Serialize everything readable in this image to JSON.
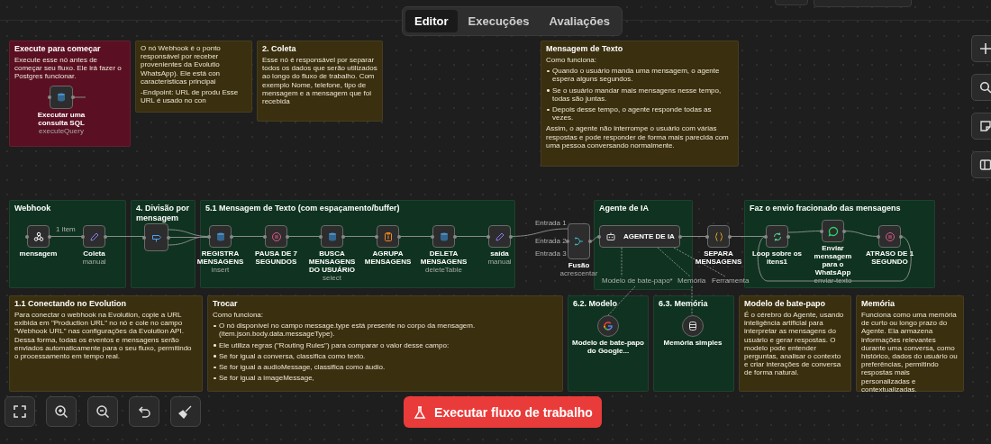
{
  "tabs": [
    {
      "label": "Editor",
      "selected": true
    },
    {
      "label": "Execuções",
      "selected": false
    },
    {
      "label": "Avaliações",
      "selected": false
    }
  ],
  "stickies": [
    {
      "title": "Execute para começar",
      "color": "#5a0f22",
      "body": [
        {
          "kind": "text",
          "text": "Execute esse nó antes de começar seu fluxo. Ele irá fazer o Postgres funcionar."
        }
      ]
    },
    {
      "color": "#3a2f0e",
      "body": [
        {
          "kind": "text",
          "text": "O nó Webhook é o ponto responsável por receber provenientes da Evolutio WhatsApp). Ele está con características principai"
        },
        {
          "kind": "text",
          "text": "-Endpoint: URL de produ Esse URL é usado no con"
        }
      ]
    },
    {
      "title": "2. Coleta",
      "color": "#3a2f0e",
      "body": [
        {
          "kind": "text",
          "text": "Esse nó é responsável por separar todos os dados que serão utilizados ao longo do fluxo de trabalho. Com exemplo Nome, telefone, tipo de mensagem e a mensagem que foi recebida"
        }
      ]
    },
    {
      "title": "Webhook",
      "color": "#0f3320"
    },
    {
      "title": "4. Divisão por mensagem",
      "color": "#0f3320"
    },
    {
      "title": "1.1 Conectando no Evolution",
      "color": "#3a2f0e",
      "body": [
        {
          "kind": "text",
          "text": "Para conectar o webhook na Evolution, copie a URL exibida em \"Production URL\" no nó e cole no campo \"Webhook URL\" nas configurações da Evolution API. Dessa forma, todas os eventos e mensagens serão enviados automaticamente para o seu fluxo, permitindo o processamento em tempo real."
        }
      ]
    },
    {
      "title": "5.1 Mensagem de Texto (com espaçamento/buffer)",
      "color": "#0f3320"
    },
    {
      "title": "Mensagem de Texto",
      "color": "#3a2f0e",
      "body": [
        {
          "kind": "text",
          "text": "Como funciona:"
        },
        {
          "kind": "bullet",
          "text": "Quando o usuário manda uma mensagem, o agente espera alguns segundos."
        },
        {
          "kind": "bullet",
          "text": "Se o usuário mandar mais mensagens nesse tempo, todas são juntas."
        },
        {
          "kind": "bullet",
          "text": "Depois desse tempo, o agente responde todas as vezes."
        },
        {
          "kind": "text",
          "text": "Assim, o agente não interrompe o usuário com várias respostas e pode responder de forma mais parecida com uma pessoa conversando normalmente."
        }
      ]
    },
    {
      "title": "Trocar",
      "color": "#3a2f0e",
      "body": [
        {
          "kind": "text",
          "text": "Como funciona:"
        },
        {
          "kind": "bullet",
          "text": "O nó disponível no campo message.type está presente no corpo da mensagem. (item.json.body.data.messageType)."
        },
        {
          "kind": "bullet",
          "text": "Ele utiliza regras (\"Routing Rules\") para comparar o valor desse campo:"
        },
        {
          "kind": "bullet",
          "text": "Se for igual a conversa, classifica como texto."
        },
        {
          "kind": "bullet",
          "text": "Se for igual a audioMessage, classifica como áudio."
        },
        {
          "kind": "bullet",
          "text": "Se for igual a imageMessage,"
        }
      ]
    },
    {
      "title": "Agente de IA",
      "color": "#0f3320"
    },
    {
      "title": "6.2. Modelo",
      "color": "#0f3320"
    },
    {
      "title": "6.3. Memória",
      "color": "#0f3320"
    },
    {
      "title": "Faz o envio fracionado das mensagens",
      "color": "#0f3320"
    },
    {
      "title": "Modelo de bate-papo",
      "color": "#3a2f0e",
      "body": [
        {
          "kind": "text",
          "text": "É o cérebro do Agente, usando inteligência artificial para interpretar as mensagens do usuário e gerar respostas. O modelo pode entender perguntas, analisar o contexto e criar interações de conversa de forma natural."
        }
      ]
    },
    {
      "title": "Memória",
      "color": "#3a2f0e",
      "body": [
        {
          "kind": "text",
          "text": "Funciona como uma memória de curto ou longo prazo do Agente. Ela armazena informações relevantes durante uma conversa, como histórico, dados do usuário ou preferências, permitindo respostas mais personalizadas e contextualizadas."
        }
      ]
    }
  ],
  "nodes": [
    {
      "label": "Executar uma consulta SQL",
      "subtitle": "executeQuery",
      "kind": "postgres"
    },
    {
      "label": "mensagem",
      "kind": "webhook"
    },
    {
      "label": "Coleta",
      "subtitle": "manual",
      "kind": "edit"
    },
    {
      "kind": "switch"
    },
    {
      "label": "REGISTRA MENSAGENS",
      "subtitle": "insert",
      "kind": "postgres"
    },
    {
      "label": "PAUSA DE 7 SEGUNDOS",
      "kind": "wait"
    },
    {
      "label": "BUSCA MENSAGENS DO USUÁRIO",
      "subtitle": "select",
      "kind": "postgres"
    },
    {
      "label": "AGRUPA MENSAGENS",
      "kind": "aggregate"
    },
    {
      "label": "DELETA MENSAGENS",
      "subtitle": "deleteTable",
      "kind": "postgres"
    },
    {
      "label": "saída",
      "subtitle": "manual",
      "kind": "edit"
    },
    {
      "label": "Fusão",
      "subtitle": "acrescentar",
      "kind": "merge"
    },
    {
      "label": "AGENTE DE IA",
      "kind": "agent"
    },
    {
      "label": "Modelo de bate-papo do Google...",
      "kind": "google"
    },
    {
      "label": "Memória simples",
      "kind": "memory"
    },
    {
      "label": "SEPARA MENSAGENS",
      "kind": "code"
    },
    {
      "label": "Loop sobre os itens1",
      "kind": "loop"
    },
    {
      "label": "Enviar mensagem para o WhatsApp",
      "subtitle": "enviar-texto",
      "kind": "whatsapp"
    },
    {
      "label": "ATRASO DE 1 SEGUNDO",
      "kind": "wait"
    }
  ],
  "port_labels": [
    "1 item",
    "Entrada 1",
    "Entrada 2",
    "Entrada 3",
    "Modelo de bate-papo*",
    "Memória",
    "Ferramenta"
  ],
  "run_button": {
    "label": "Executar fluxo de trabalho"
  }
}
